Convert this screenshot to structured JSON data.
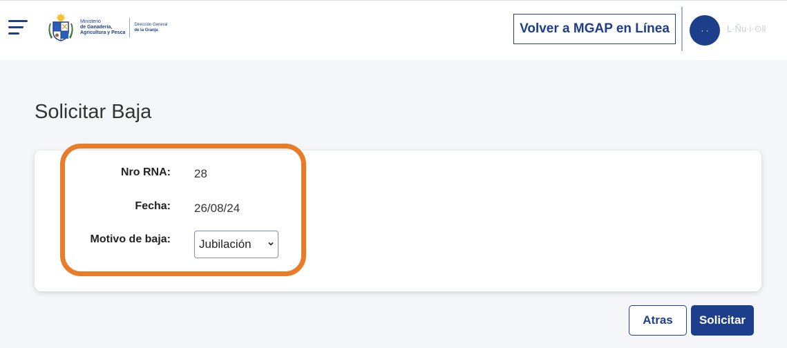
{
  "header": {
    "menu_icon": "hamburger-menu-icon",
    "logo": {
      "seal_icon": "uruguay-coat-of-arms-icon",
      "ministry_line1": "Ministerio",
      "ministry_line2": "de Ganadería,",
      "ministry_line3": "Agricultura y Pesca",
      "dept_line1": "Dirección General",
      "dept_line2": "de la Granja"
    },
    "back_button": "Volver a MGAP en Línea",
    "user": {
      "avatar_initials": "· ·",
      "name": "L·Ñu·i·⊙ll"
    }
  },
  "main": {
    "title": "Solicitar Baja",
    "form": {
      "rna_label": "Nro RNA:",
      "rna_value": "28",
      "fecha_label": "Fecha:",
      "fecha_value": "26/08/24",
      "motivo_label": "Motivo de baja:",
      "motivo_selected": "Jubilación"
    },
    "buttons": {
      "atras": "Atras",
      "solicitar": "Solicitar"
    }
  },
  "colors": {
    "primary": "#1d3e8a",
    "highlight": "#ea7b28",
    "background": "#f4f6fa"
  }
}
